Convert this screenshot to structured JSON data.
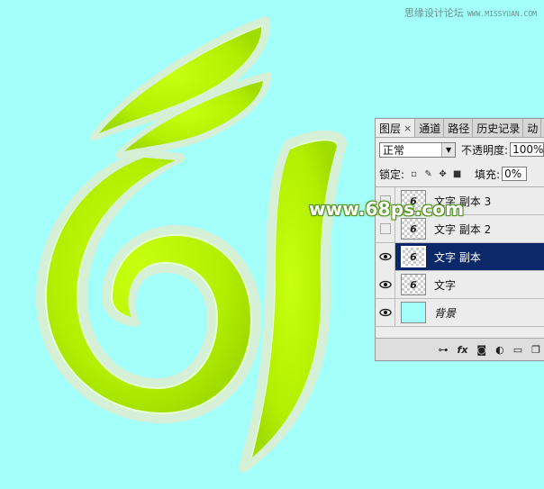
{
  "watermark": {
    "text": "思缘设计论坛",
    "sub": "WWW.MISSYUAN.COM"
  },
  "site_watermark": "www.68ps.com",
  "colors": {
    "background": "#a3fff9",
    "lime": "#b4f000",
    "selected": "#0b2868"
  },
  "panel": {
    "tabs": [
      {
        "label": "图层",
        "close": "×"
      },
      {
        "label": "通道"
      },
      {
        "label": "路径"
      },
      {
        "label": "历史记录"
      },
      {
        "label": "动"
      }
    ],
    "blend_mode": "正常",
    "opacity_label": "不透明度:",
    "opacity_value": "100%",
    "lock_label": "锁定:",
    "fill_label": "填充:",
    "fill_value": "0%",
    "layers": [
      {
        "name": "文字 副本 3",
        "visible": false,
        "thumb": "6"
      },
      {
        "name": "文字 副本 2",
        "visible": false,
        "thumb": "6"
      },
      {
        "name": "文字 副本",
        "visible": true,
        "thumb": "6",
        "selected": true
      },
      {
        "name": "文字",
        "visible": true,
        "thumb": "6"
      },
      {
        "name": "背景",
        "visible": true,
        "thumb": ""
      }
    ],
    "footer_icons": [
      "link-icon",
      "fx-icon",
      "mask-icon",
      "adjustment-icon",
      "folder-icon",
      "new-layer-icon"
    ]
  }
}
